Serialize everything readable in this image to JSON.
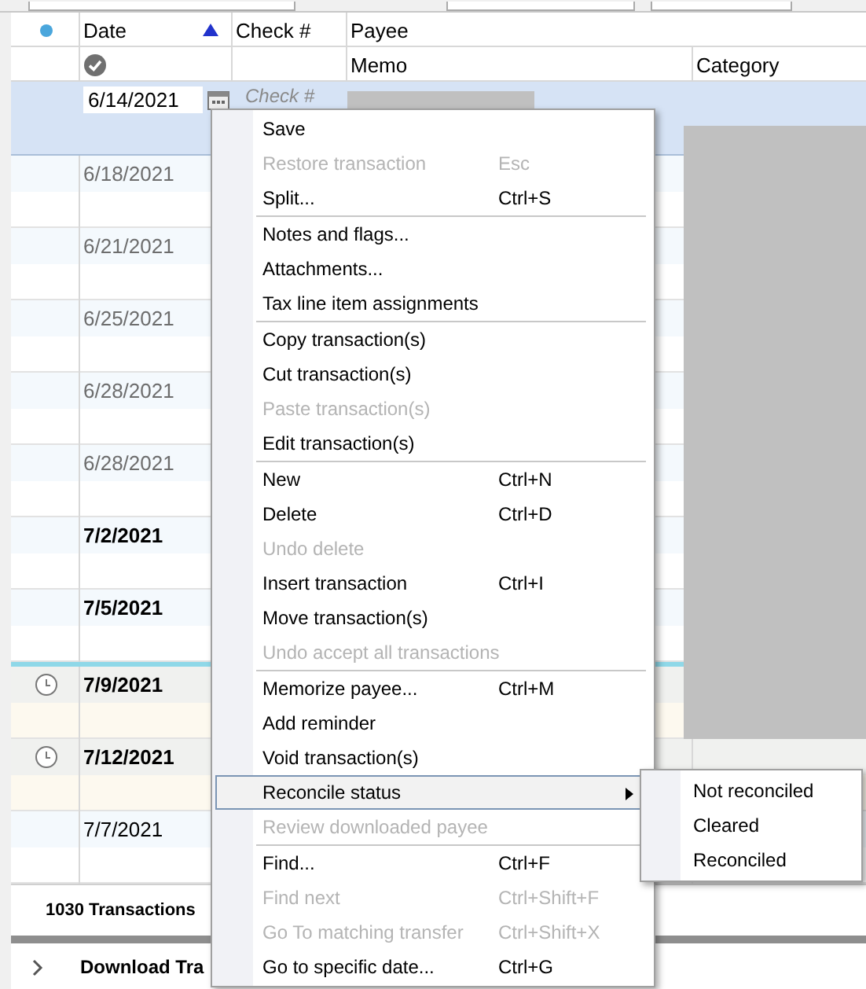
{
  "header": {
    "date": "Date",
    "check": "Check #",
    "payee": "Payee",
    "memo": "Memo",
    "category": "Category"
  },
  "edit_row": {
    "date": "6/14/2021",
    "check_placeholder": "Check #"
  },
  "rows": [
    {
      "date": "6/18/2021",
      "dimmed": true,
      "bold": false,
      "scheduled": false,
      "divider_above": false
    },
    {
      "date": "6/21/2021",
      "dimmed": true,
      "bold": false,
      "scheduled": false,
      "divider_above": false
    },
    {
      "date": "6/25/2021",
      "dimmed": true,
      "bold": false,
      "scheduled": false,
      "divider_above": false
    },
    {
      "date": "6/28/2021",
      "dimmed": true,
      "bold": false,
      "scheduled": false,
      "divider_above": false
    },
    {
      "date": "6/28/2021",
      "dimmed": true,
      "bold": false,
      "scheduled": false,
      "divider_above": false
    },
    {
      "date": "7/2/2021",
      "dimmed": false,
      "bold": true,
      "scheduled": false,
      "divider_above": false
    },
    {
      "date": "7/5/2021",
      "dimmed": false,
      "bold": true,
      "scheduled": false,
      "divider_above": false
    },
    {
      "date": "7/9/2021",
      "dimmed": false,
      "bold": true,
      "scheduled": true,
      "divider_above": true
    },
    {
      "date": "7/12/2021",
      "dimmed": false,
      "bold": true,
      "scheduled": true,
      "divider_above": false
    },
    {
      "date": "7/7/2021",
      "dimmed": false,
      "bold": false,
      "scheduled": false,
      "divider_above": false
    }
  ],
  "footer": {
    "count": "1030 Transactions"
  },
  "download_bar": {
    "label": "Download Tra"
  },
  "menu": {
    "groups": [
      [
        {
          "label": "Save",
          "disabled": false,
          "submenu": false,
          "highlighted": false
        },
        {
          "label": "Restore transaction",
          "shortcut": "Esc",
          "disabled": true,
          "submenu": false,
          "highlighted": false
        },
        {
          "label": "Split...",
          "shortcut": "Ctrl+S",
          "disabled": false,
          "submenu": false,
          "highlighted": false
        }
      ],
      [
        {
          "label": "Notes and flags...",
          "disabled": false,
          "submenu": false,
          "highlighted": false
        },
        {
          "label": "Attachments...",
          "disabled": false,
          "submenu": false,
          "highlighted": false
        },
        {
          "label": "Tax line item assignments",
          "disabled": false,
          "submenu": false,
          "highlighted": false
        }
      ],
      [
        {
          "label": "Copy transaction(s)",
          "disabled": false,
          "submenu": false,
          "highlighted": false
        },
        {
          "label": "Cut transaction(s)",
          "disabled": false,
          "submenu": false,
          "highlighted": false
        },
        {
          "label": "Paste transaction(s)",
          "disabled": true,
          "submenu": false,
          "highlighted": false
        },
        {
          "label": "Edit transaction(s)",
          "disabled": false,
          "submenu": false,
          "highlighted": false
        }
      ],
      [
        {
          "label": "New",
          "shortcut": "Ctrl+N",
          "disabled": false,
          "submenu": false,
          "highlighted": false
        },
        {
          "label": "Delete",
          "shortcut": "Ctrl+D",
          "disabled": false,
          "submenu": false,
          "highlighted": false
        },
        {
          "label": "Undo delete",
          "disabled": true,
          "submenu": false,
          "highlighted": false
        },
        {
          "label": "Insert transaction",
          "shortcut": "Ctrl+I",
          "disabled": false,
          "submenu": false,
          "highlighted": false
        },
        {
          "label": "Move transaction(s)",
          "disabled": false,
          "submenu": false,
          "highlighted": false
        },
        {
          "label": "Undo accept all transactions",
          "disabled": true,
          "submenu": false,
          "highlighted": false
        }
      ],
      [
        {
          "label": "Memorize payee...",
          "shortcut": "Ctrl+M",
          "disabled": false,
          "submenu": false,
          "highlighted": false
        },
        {
          "label": "Add reminder",
          "disabled": false,
          "submenu": false,
          "highlighted": false
        },
        {
          "label": "Void transaction(s)",
          "disabled": false,
          "submenu": false,
          "highlighted": false
        },
        {
          "label": "Reconcile status",
          "disabled": false,
          "submenu": true,
          "highlighted": true
        },
        {
          "label": "Review downloaded payee",
          "disabled": true,
          "submenu": false,
          "highlighted": false
        }
      ],
      [
        {
          "label": "Find...",
          "shortcut": "Ctrl+F",
          "disabled": false,
          "submenu": false,
          "highlighted": false
        },
        {
          "label": "Find next",
          "shortcut": "Ctrl+Shift+F",
          "disabled": true,
          "submenu": false,
          "highlighted": false
        },
        {
          "label": "Go To matching transfer",
          "shortcut": "Ctrl+Shift+X",
          "disabled": true,
          "submenu": false,
          "highlighted": false
        },
        {
          "label": "Go to specific date...",
          "shortcut": "Ctrl+G",
          "disabled": false,
          "submenu": false,
          "highlighted": false
        }
      ]
    ]
  },
  "submenu": {
    "items": [
      "Not reconciled",
      "Cleared",
      "Reconciled"
    ]
  }
}
